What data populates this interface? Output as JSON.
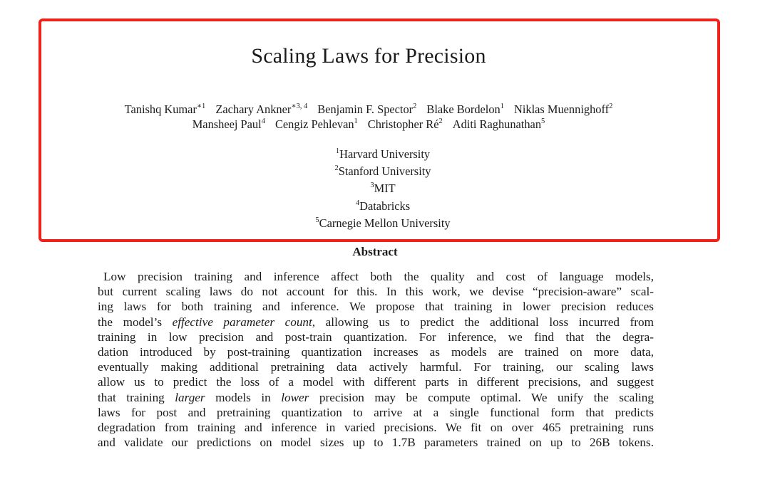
{
  "paper": {
    "title": "Scaling Laws for Precision",
    "highlight_color": "#f0201a",
    "authors_line1": [
      {
        "name": "Tanishq Kumar",
        "marks": "∗1"
      },
      {
        "name": "Zachary Ankner",
        "marks": "∗3, 4"
      },
      {
        "name": "Benjamin F. Spector",
        "marks": "2"
      },
      {
        "name": "Blake Bordelon",
        "marks": "1"
      },
      {
        "name": "Niklas Muennighoff",
        "marks": "2"
      }
    ],
    "authors_line2": [
      {
        "name": "Mansheej Paul",
        "marks": "4"
      },
      {
        "name": "Cengiz Pehlevan",
        "marks": "1"
      },
      {
        "name": "Christopher Ré",
        "marks": "2"
      },
      {
        "name": "Aditi Raghunathan",
        "marks": "5"
      }
    ],
    "affiliations": [
      {
        "mark": "1",
        "name": "Harvard University"
      },
      {
        "mark": "2",
        "name": "Stanford University"
      },
      {
        "mark": "3",
        "name": "MIT"
      },
      {
        "mark": "4",
        "name": "Databricks"
      },
      {
        "mark": "5",
        "name": "Carnegie Mellon University"
      }
    ],
    "abstract_heading": "Abstract",
    "abstract_lines": [
      [
        "Low precision training and inference affect both the quality and cost of language models,"
      ],
      [
        "but current scaling laws do not account for this. In this work, we devise “precision-aware” scal-"
      ],
      [
        "ing laws for both training and inference. We propose that training in lower precision reduces"
      ],
      [
        "the model’s ",
        {
          "em": "effective parameter count"
        },
        ", allowing us to predict the additional loss incurred from"
      ],
      [
        "training in low precision and post-train quantization. For inference, we find that the degra-"
      ],
      [
        "dation introduced by post-training quantization increases as models are trained on more data,"
      ],
      [
        "eventually making additional pretraining data actively harmful. For training, our scaling laws"
      ],
      [
        "allow us to predict the loss of a model with different parts in different precisions, and suggest"
      ],
      [
        "that training ",
        {
          "em": "larger"
        },
        " models in ",
        {
          "em": "lower"
        },
        " precision may be compute optimal. We unify the scaling"
      ],
      [
        "laws for post and pretraining quantization to arrive at a single functional form that predicts"
      ],
      [
        "degradation from training and inference in varied precisions. We fit on over 465 pretraining runs"
      ],
      [
        "and validate our predictions on model sizes up to 1.7B parameters trained on up to 26B tokens."
      ]
    ]
  }
}
